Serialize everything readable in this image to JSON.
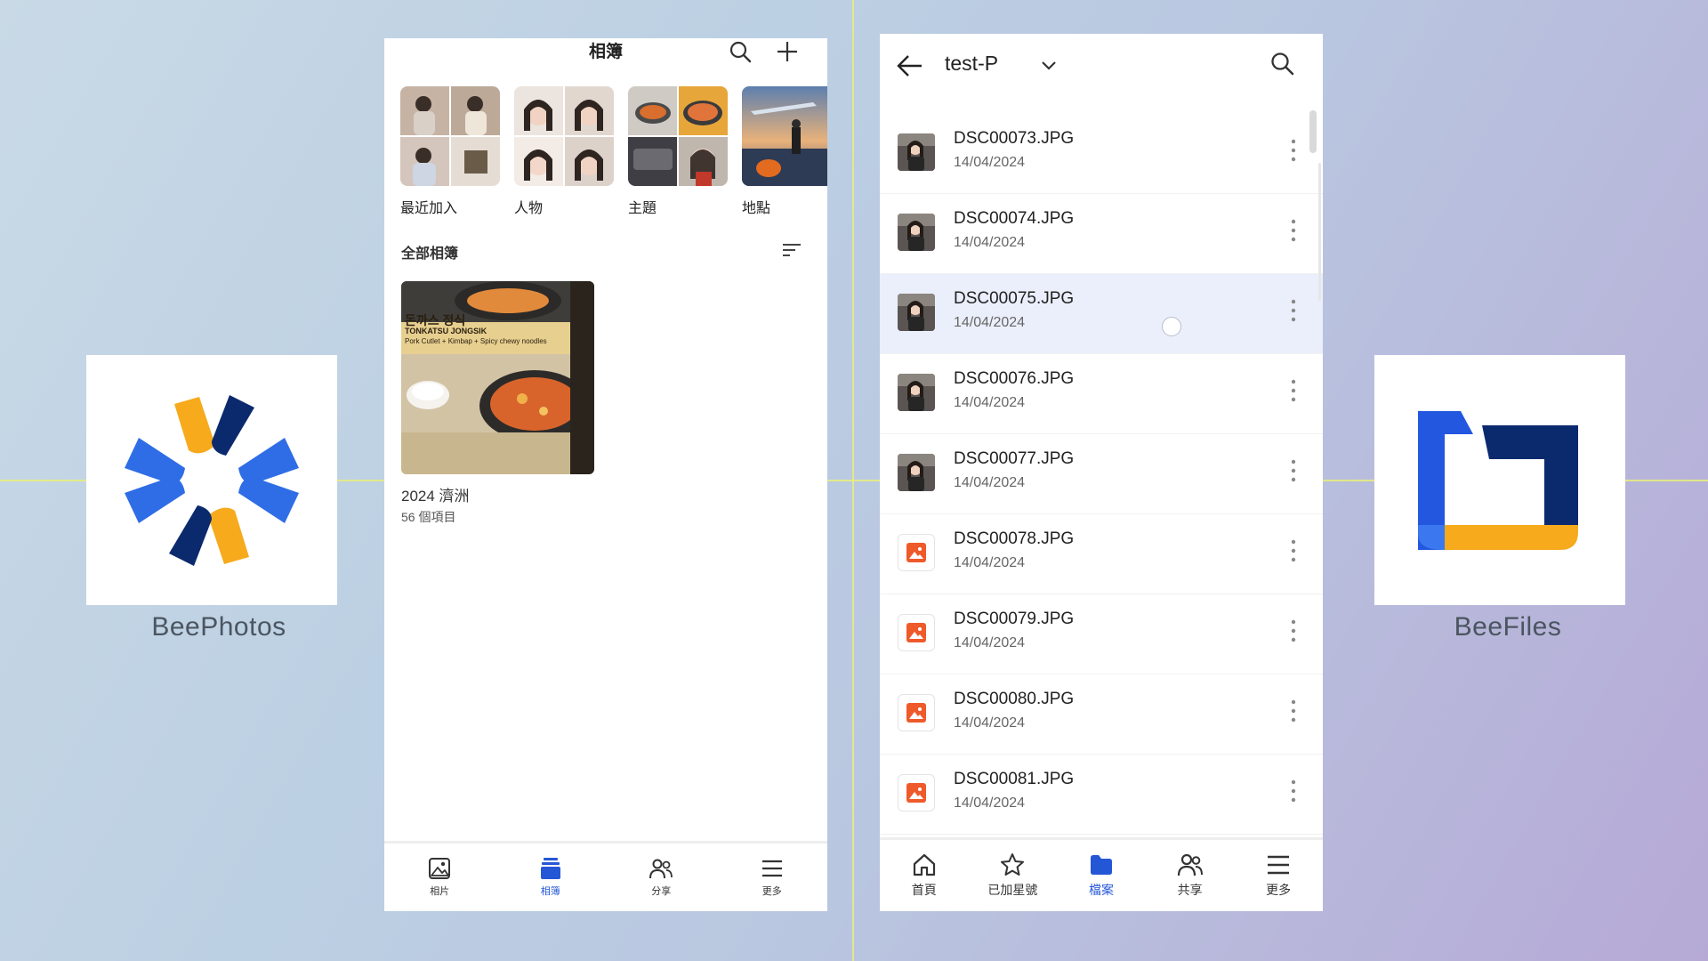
{
  "logos": {
    "photos_label": "BeePhotos",
    "files_label": "BeeFiles"
  },
  "photos_app": {
    "title": "相簿",
    "categories": [
      {
        "label": "最近加入",
        "icon": "collage-thumbnail"
      },
      {
        "label": "人物",
        "icon": "faces-thumbnail"
      },
      {
        "label": "主題",
        "icon": "food-thumbnail"
      },
      {
        "label": "地點",
        "icon": "sunset-thumbnail"
      }
    ],
    "section_title": "全部相簿",
    "album": {
      "name": "2024 濟洲",
      "count": "56 個項目",
      "thumb_text_1": "돈까스 정식",
      "thumb_text_2": "TONKATSU JONGSIK",
      "thumb_text_3": "Pork Cutlet + Kimbap + Spicy chewy noodles"
    },
    "tabs": [
      {
        "label": "相片",
        "icon": "image-icon",
        "active": false
      },
      {
        "label": "相簿",
        "icon": "albums-icon",
        "active": true
      },
      {
        "label": "分享",
        "icon": "people-icon",
        "active": false
      },
      {
        "label": "更多",
        "icon": "menu-icon",
        "active": false
      }
    ]
  },
  "files_app": {
    "title": "test-P",
    "files": [
      {
        "name": "DSC00073.JPG",
        "date": "14/04/2024",
        "thumb": "photo"
      },
      {
        "name": "DSC00074.JPG",
        "date": "14/04/2024",
        "thumb": "photo"
      },
      {
        "name": "DSC00075.JPG",
        "date": "14/04/2024",
        "thumb": "photo"
      },
      {
        "name": "DSC00076.JPG",
        "date": "14/04/2024",
        "thumb": "photo"
      },
      {
        "name": "DSC00077.JPG",
        "date": "14/04/2024",
        "thumb": "photo"
      },
      {
        "name": "DSC00078.JPG",
        "date": "14/04/2024",
        "thumb": "image-icon"
      },
      {
        "name": "DSC00079.JPG",
        "date": "14/04/2024",
        "thumb": "image-icon"
      },
      {
        "name": "DSC00080.JPG",
        "date": "14/04/2024",
        "thumb": "image-icon"
      },
      {
        "name": "DSC00081.JPG",
        "date": "14/04/2024",
        "thumb": "image-icon"
      }
    ],
    "selected_file": "DSC00075.JPG",
    "tabs": [
      {
        "label": "首頁",
        "icon": "home-icon",
        "active": false
      },
      {
        "label": "已加星號",
        "icon": "star-icon",
        "active": false
      },
      {
        "label": "檔案",
        "icon": "folder-icon",
        "active": true
      },
      {
        "label": "共享",
        "icon": "people-icon",
        "active": false
      },
      {
        "label": "更多",
        "icon": "menu-icon",
        "active": false
      }
    ]
  },
  "colors": {
    "accent_blue": "#2457d6",
    "logo_yellow": "#f6aa1c",
    "logo_blue": "#2f6de6",
    "logo_navy": "#0b2a6e",
    "image_icon_orange": "#ef5a2a",
    "selected_row": "#ebeffb"
  }
}
